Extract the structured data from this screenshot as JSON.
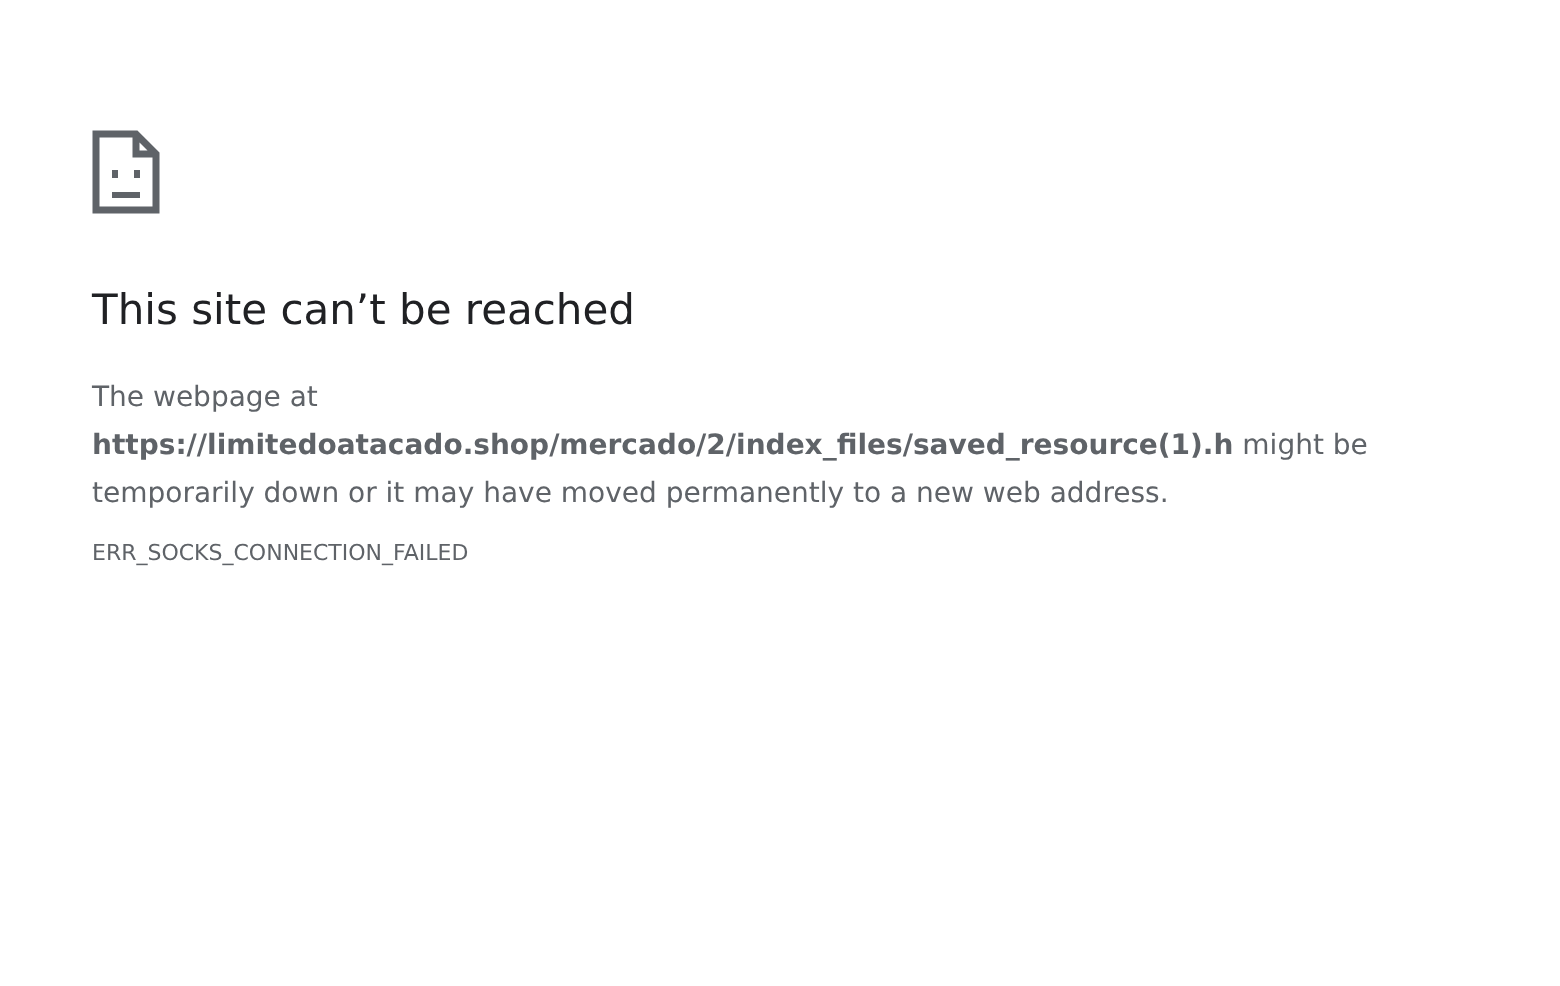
{
  "heading": "This site can’t be reached",
  "message": "The webpage at **https://limitedoatacado.shop/mercado/2/index_files/saved_resource(1).h** might be temporarily down or it may have moved permanently to a new web address.",
  "error_code": "ERR_SOCKS_CONNECTION_FAILED"
}
